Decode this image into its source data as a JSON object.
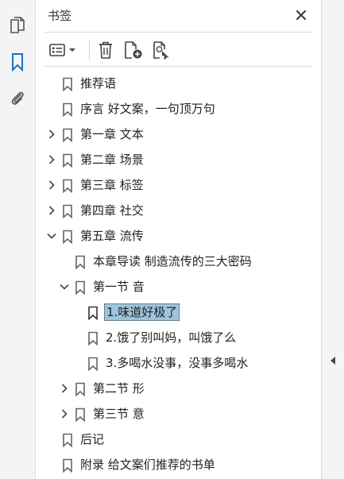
{
  "panel": {
    "title": "书签"
  },
  "left_rail": {
    "items": [
      {
        "icon": "pages-icon"
      },
      {
        "icon": "bookmark-icon",
        "active": true
      },
      {
        "icon": "attachment-icon"
      }
    ]
  },
  "toolbar": {
    "buttons": [
      "options-dropdown-icon",
      "delete-icon",
      "new-bookmark-icon",
      "new-bookmark-from-structure-icon"
    ]
  },
  "tree": {
    "items": [
      {
        "label": "推荐语",
        "level": 0,
        "expander": "none"
      },
      {
        "label": "序言 好文案，一句顶万句",
        "level": 0,
        "expander": "none"
      },
      {
        "label": "第一章 文本",
        "level": 0,
        "expander": "collapsed"
      },
      {
        "label": "第二章 场景",
        "level": 0,
        "expander": "collapsed"
      },
      {
        "label": "第三章 标签",
        "level": 0,
        "expander": "collapsed"
      },
      {
        "label": "第四章 社交",
        "level": 0,
        "expander": "collapsed"
      },
      {
        "label": "第五章 流传",
        "level": 0,
        "expander": "expanded"
      },
      {
        "label": "本章导读 制造流传的三大密码",
        "level": 1,
        "expander": "none"
      },
      {
        "label": "第一节 音",
        "level": 1,
        "expander": "expanded"
      },
      {
        "label": "1.味道好极了",
        "level": 2,
        "expander": "none",
        "selected": true
      },
      {
        "label": "2.饿了别叫妈，叫饿了么",
        "level": 2,
        "expander": "none"
      },
      {
        "label": "3.多喝水没事，没事多喝水",
        "level": 2,
        "expander": "none"
      },
      {
        "label": "第二节 形",
        "level": 1,
        "expander": "collapsed"
      },
      {
        "label": "第三节 意",
        "level": 1,
        "expander": "collapsed"
      },
      {
        "label": "后记",
        "level": 0,
        "expander": "none"
      },
      {
        "label": "附录 给文案们推荐的书单",
        "level": 0,
        "expander": "none"
      }
    ]
  },
  "colors": {
    "accent": "#1a73c8",
    "selected_bg": "#9ec4dc",
    "icon_gray": "#555555"
  }
}
